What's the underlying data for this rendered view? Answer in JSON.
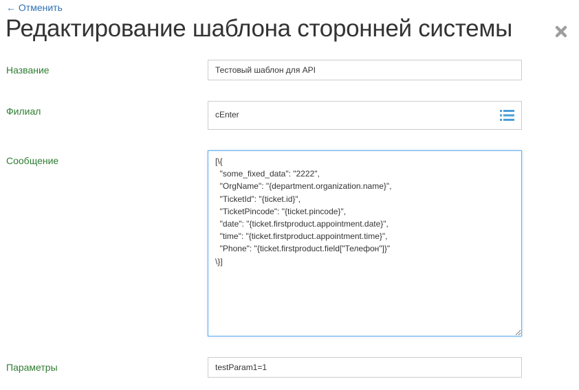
{
  "nav": {
    "back_label": "← Отменить"
  },
  "header": {
    "title": "Редактирование шаблона сторонней системы"
  },
  "form": {
    "name": {
      "label": "Название",
      "value": "Тестовый шаблон для API"
    },
    "branch": {
      "label": "Филиал",
      "value": "cEnter",
      "icon": "list-icon"
    },
    "message": {
      "label": "Сообщение",
      "value": "[\\{\n  \"some_fixed_data\": \"2222\",\n  \"OrgName\": \"{department.organization.name}\",\n  \"TicketId\": \"{ticket.id}\",\n  \"TicketPincode\": \"{ticket.pincode}\",\n  \"date\": \"{ticket.firstproduct.appointment.date}\",\n  \"time\": \"{ticket.firstproduct.appointment.time}\",\n  \"Phone\": \"{ticket.firstproduct.field[\"Телефон\"]}\"\n\\}]"
    },
    "params": {
      "label": "Параметры",
      "value": "testParam1=1"
    }
  },
  "colors": {
    "label": "#2e7d32",
    "link": "#2f6fb3",
    "focus": "#66afe9",
    "icon": "#4a9fd8"
  }
}
